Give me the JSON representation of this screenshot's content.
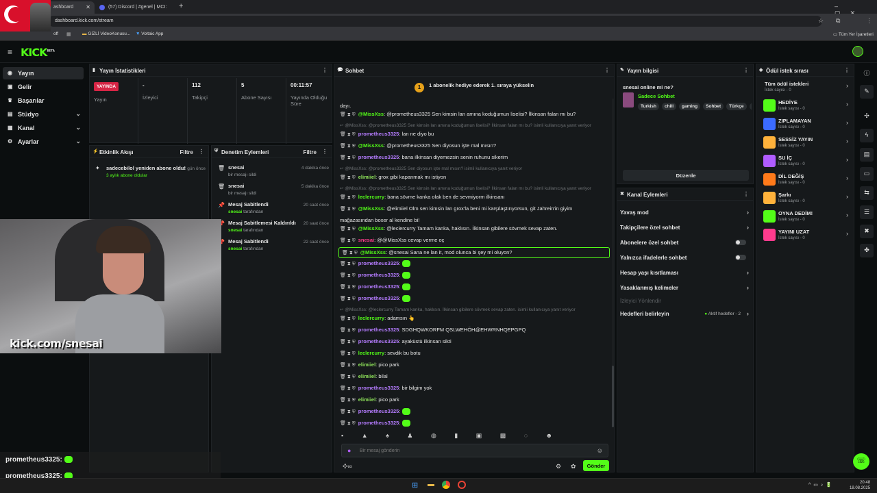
{
  "browser": {
    "tabs": [
      {
        "label": "ashboard",
        "active": true
      },
      {
        "label": "(57) Discord | #genel | MCI:",
        "active": false
      }
    ],
    "url": "dashboard.kick.com/stream",
    "bookmarks": [
      "off",
      "GİZLİ VideoKonusu...",
      "Voltaic App"
    ],
    "all_bookmarks": "Tüm Yer İşaretleri"
  },
  "kick": {
    "logo": "KICK",
    "beta": "BETA"
  },
  "nav": [
    {
      "label": "Yayın",
      "icon": "broadcast-icon",
      "active": true,
      "chevron": false
    },
    {
      "label": "Gelir",
      "icon": "wallet-icon",
      "active": false,
      "chevron": false
    },
    {
      "label": "Başarılar",
      "icon": "trophy-icon",
      "active": false,
      "chevron": false
    },
    {
      "label": "Stüdyo",
      "icon": "studio-icon",
      "active": false,
      "chevron": true
    },
    {
      "label": "Kanal",
      "icon": "channel-icon",
      "active": false,
      "chevron": true
    },
    {
      "label": "Ayarlar",
      "icon": "gear-icon",
      "active": false,
      "chevron": true
    }
  ],
  "stream_stats": {
    "title": "Yayın İstatistikleri",
    "items": [
      {
        "value": "YAYINDA",
        "label": "Yayın",
        "is_badge": true
      },
      {
        "value": "-",
        "label": "İzleyici"
      },
      {
        "value": "112",
        "label": "Takipçi"
      },
      {
        "value": "5",
        "label": "Abone Sayısı"
      },
      {
        "value": "00:11:57",
        "label": "Yayında Olduğu Süre"
      }
    ]
  },
  "activity": {
    "title": "Etkinlik Akışı",
    "filter": "Filtre",
    "items": [
      {
        "title": "sadecebilol yeniden abone oldu!",
        "sub": "3 aylık abone oldular",
        "time": "2 gün önce"
      }
    ]
  },
  "moderation": {
    "title": "Denetim Eylemleri",
    "filter": "Filtre",
    "items": [
      {
        "title": "snesai",
        "sub_user": "",
        "sub": "bir mesajı sildi",
        "time": "4 dakika önce"
      },
      {
        "title": "snesai",
        "sub_user": "",
        "sub": "bir mesajı sildi",
        "time": "5 dakika önce"
      },
      {
        "title": "Mesaj Sabitlendi",
        "sub_user": "snesai",
        "sub": "tarafından",
        "time": "20 saat önce"
      },
      {
        "title": "Mesaj Sabitlemesi Kaldırıldı",
        "sub_user": "snesai",
        "sub": "tarafından",
        "time": "20 saat önce"
      },
      {
        "title": "Mesaj Sabitlendi",
        "sub_user": "snesai",
        "sub": "tarafından",
        "time": "22 saat önce"
      }
    ]
  },
  "chat": {
    "title": "Sohbet",
    "banner_num": "1",
    "banner": "1 abonelik hediye ederek 1. sıraya yükselin",
    "lines": [
      {
        "type": "msg",
        "user": "",
        "color": "#e6e6e6",
        "text": "dayı."
      },
      {
        "type": "msg",
        "user": "@MissXss",
        "color": "#53fc18",
        "text": "@prometheus3325 Sen kimsin lan amına koduğumun liselisi? İlkinsan falan mı bu?"
      },
      {
        "type": "reply",
        "text": "@MissXss: @prometheus3325 Sen kimsin lan amına koduğumun liselisi? İlkinsan falan mı bu? isimli kullanıcıya yanıt veriyor"
      },
      {
        "type": "msg",
        "user": "prometheus3325",
        "color": "#b57cff",
        "text": "lan ne diyo bu"
      },
      {
        "type": "msg",
        "user": "@MissXss",
        "color": "#53fc18",
        "text": "@prometheus3325 Sen diyosun işte mal mısın?"
      },
      {
        "type": "msg",
        "user": "prometheus3325",
        "color": "#b57cff",
        "text": "bana ilkinsan diyemezsin senin ruhunu sikerim"
      },
      {
        "type": "reply",
        "text": "@MissXss: @prometheus3325 Sen diyosun işte mal mısın? isimli kullanıcıya yanıt veriyor"
      },
      {
        "type": "msg",
        "user": "elimiiel",
        "color": "#8fe35a",
        "text": "grox gibi kapanmak mı istiyon"
      },
      {
        "type": "reply",
        "text": "@MissXss: @prometheus3325 Sen kimsin lan amına koduğumun liselisi? İlkinsan falan mı bu? isimli kullanıcıya yanıt veriyor"
      },
      {
        "type": "msg",
        "user": "leclercurry",
        "color": "#53fc18",
        "text": "bana sövme kanka olak ben de sevmiyorm ilkinsanı"
      },
      {
        "type": "msg",
        "user": "@MissXss",
        "color": "#53fc18",
        "text": "@elimiiel Olm sen kimsin lan grox'la beni mi karşılaştırıyorsun, git Jahrein'in giyim"
      },
      {
        "type": "msg",
        "user": "",
        "color": "#e6e6e6",
        "text": "mağazasından boxer al kendine bi!"
      },
      {
        "type": "msg",
        "user": "@MissXss",
        "color": "#53fc18",
        "text": "@leclercurry Tamam kanka, haklısın. İlkinsan gibilere sövmek sevap zaten."
      },
      {
        "type": "msg",
        "user": "snesai",
        "color": "#ff3b8d",
        "text": "@@MissXss cevap verme oç"
      },
      {
        "type": "msg",
        "user": "@MissXss",
        "color": "#53fc18",
        "text": "@snesai Sana ne lan it, mod olunca bi şey mi oluyon?",
        "highlight": true
      },
      {
        "type": "msg",
        "user": "prometheus3325",
        "color": "#b57cff",
        "text": "",
        "emote": true
      },
      {
        "type": "msg",
        "user": "prometheus3325",
        "color": "#b57cff",
        "text": "",
        "emote": true
      },
      {
        "type": "msg",
        "user": "prometheus3325",
        "color": "#b57cff",
        "text": "",
        "emote": true
      },
      {
        "type": "msg",
        "user": "prometheus3325",
        "color": "#b57cff",
        "text": "",
        "emote": true
      },
      {
        "type": "reply",
        "text": "@MissXss: @leclercurry Tamam kanka, haklısın. İlkinsan gibilere sövmek sevap zaten. isimli kullanıcıya yanıt veriyor"
      },
      {
        "type": "msg",
        "user": "leclercurry",
        "color": "#53fc18",
        "text": "adamsın 👆"
      },
      {
        "type": "msg",
        "user": "prometheus3325",
        "color": "#b57cff",
        "text": "SDGHQWKORFM QSLWEHÖH@EHWRNHQEPGPQ"
      },
      {
        "type": "msg",
        "user": "prometheus3325",
        "color": "#b57cff",
        "text": "ayaküstü ilkinsan sikti"
      },
      {
        "type": "msg",
        "user": "leclercurry",
        "color": "#53fc18",
        "text": "sevdik bu botu"
      },
      {
        "type": "msg",
        "user": "elimiiel",
        "color": "#8fe35a",
        "text": "pico park"
      },
      {
        "type": "msg",
        "user": "elimiiel",
        "color": "#8fe35a",
        "text": "bilal"
      },
      {
        "type": "msg",
        "user": "prometheus3325",
        "color": "#b57cff",
        "text": "bir bilgim yok"
      },
      {
        "type": "msg",
        "user": "elimiiel",
        "color": "#8fe35a",
        "text": "pico park"
      },
      {
        "type": "msg",
        "user": "prometheus3325",
        "color": "#b57cff",
        "text": "",
        "emote": true
      },
      {
        "type": "msg",
        "user": "prometheus3325",
        "color": "#b57cff",
        "text": "",
        "emote": true
      }
    ],
    "input_placeholder": "Bir mesaj gönderin",
    "send": "Gönder"
  },
  "stream_info": {
    "title": "Yayın bilgisi",
    "stream_title": "snesai online mi ne?",
    "category": "Sadece Sohbet",
    "tags": [
      "Turkish",
      "chill",
      "gaming",
      "Sohbet",
      "Türkçe",
      "k"
    ],
    "edit": "Düzenle"
  },
  "channel_actions": {
    "title": "Kanal Eylemleri",
    "items": [
      {
        "label": "Yavaş mod",
        "kind": "chevron"
      },
      {
        "label": "Takipçilere özel sohbet",
        "kind": "chevron"
      },
      {
        "label": "Abonelere özel sohbet",
        "kind": "toggle"
      },
      {
        "label": "Yalnızca ifadelerle sohbet",
        "kind": "toggle"
      },
      {
        "label": "Hesap yaşı kısıtlaması",
        "kind": "chevron"
      },
      {
        "label": "Yasaklanmış kelimeler",
        "kind": "chevron"
      },
      {
        "label": "İzleyici Yönlendir",
        "kind": "disabled"
      },
      {
        "label": "Hedefleri belirleyin",
        "kind": "goals"
      }
    ],
    "goals_status": "Aktif hedefler - 2"
  },
  "rewards": {
    "title": "Ödül istek sırası",
    "all": "Tüm ödül istekleri",
    "all_sub": "İstek sayısı - 0",
    "items": [
      {
        "name": "HEDİYE",
        "sub": "İstek sayısı - 0",
        "color": "#53fc18"
      },
      {
        "name": "ZIPLAMAYAN",
        "sub": "İstek sayısı - 0",
        "color": "#3b6bff"
      },
      {
        "name": "SESSİZ YAYIN",
        "sub": "İstek sayısı - 0",
        "color": "#ffb23b"
      },
      {
        "name": "SU İÇ",
        "sub": "İstek sayısı - 0",
        "color": "#b05cff"
      },
      {
        "name": "DİL DEĞİŞ",
        "sub": "İstek sayısı - 0",
        "color": "#ff7a1a"
      },
      {
        "name": "Şarkı",
        "sub": "İstek sayısı - 0",
        "color": "#ffb23b"
      },
      {
        "name": "OYNA DEDİM!",
        "sub": "İstek sayısı - 0",
        "color": "#53fc18"
      },
      {
        "name": "YAYINI UZAT",
        "sub": "İstek sayısı - 0",
        "color": "#ff3b8d"
      }
    ]
  },
  "overlay": {
    "cam_text": "kick.com/snesai",
    "chat": [
      {
        "user": "prometheus3325:"
      },
      {
        "user": "prometheus3325:"
      }
    ]
  },
  "taskbar": {
    "time": "20:48",
    "date": "18.08.2025"
  }
}
